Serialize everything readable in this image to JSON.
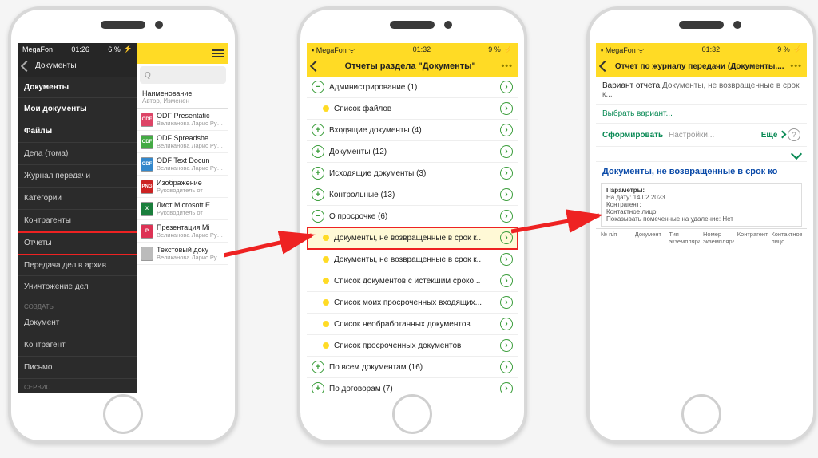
{
  "status": {
    "carrier": "MegaFon",
    "sig": "▪",
    "wifi": "ᯤ",
    "time1": "01:26",
    "time2": "01:32",
    "batt1": "6 %",
    "batt2": "9 %",
    "battic": "⚡"
  },
  "p1": {
    "sidebar": {
      "title": "Документы",
      "items": [
        "Документы",
        "Мои документы",
        "Файлы",
        "Дела (тома)",
        "Журнал передачи",
        "Категории",
        "Контрагенты",
        "Отчеты",
        "Передача дел в архив",
        "Уничтожение дел"
      ],
      "create": "СОЗДАТЬ",
      "create_items": [
        "Документ",
        "Контрагент",
        "Письмо"
      ],
      "service": "СЕРВИС"
    },
    "right": {
      "colhdr": "Наименование",
      "colsub": "Автор, Изменен",
      "files": [
        {
          "ic": "ODF",
          "c": "#d46",
          "n": "ODF Presentatiс",
          "m": "Великанова Ларис  Руководитель от"
        },
        {
          "ic": "ODF",
          "c": "#4a4",
          "n": "ODF Spreadshe",
          "m": "Великанова Ларис  Руководитель от"
        },
        {
          "ic": "ODF",
          "c": "#38c",
          "n": "ODF Text Docun",
          "m": "Великанова Ларис  Руководитель от"
        },
        {
          "ic": "PNG",
          "c": "#c22",
          "n": "Изображение",
          "m": "Руководитель от"
        },
        {
          "ic": "X",
          "c": "#1a7e3c",
          "n": "Лист Microsoft E",
          "m": "Руководитель от"
        },
        {
          "ic": "P",
          "c": "#d35",
          "n": "Презентация Mi",
          "m": "Великанова Ларис  Руководитель от"
        },
        {
          "ic": "",
          "c": "#bbb",
          "n": "Текстовый доку",
          "m": "Великанова Ларис  Руководитель от"
        }
      ]
    }
  },
  "p2": {
    "title": "Отчеты раздела \"Документы\"",
    "groups": [
      {
        "t": "minus",
        "label": "Администрирование (1)"
      },
      {
        "t": "bullet",
        "label": "Список файлов"
      },
      {
        "t": "plus",
        "label": "Входящие документы (4)"
      },
      {
        "t": "plus",
        "label": "Документы (12)"
      },
      {
        "t": "plus",
        "label": "Исходящие документы (3)"
      },
      {
        "t": "plus",
        "label": "Контрольные (13)"
      },
      {
        "t": "minus",
        "label": "О просрочке (6)"
      },
      {
        "t": "bullet",
        "label": "Документы, не возвращенные в срок к...",
        "hl": true
      },
      {
        "t": "bullet",
        "label": "Документы, не возвращенные в срок к..."
      },
      {
        "t": "bullet",
        "label": "Список документов с истекшим сроко..."
      },
      {
        "t": "bullet",
        "label": "Список моих просроченных входящих..."
      },
      {
        "t": "bullet",
        "label": "Список необработанных документов"
      },
      {
        "t": "bullet",
        "label": "Список просроченных документов"
      },
      {
        "t": "plus",
        "label": "По всем документам (16)"
      },
      {
        "t": "plus",
        "label": "По договорам (7)"
      },
      {
        "t": "plus",
        "label": "По задачам и процессам (1)"
      },
      {
        "t": "plus",
        "label": "По исполнителям (5)"
      }
    ]
  },
  "p3": {
    "title": "Отчет по журналу передачи (Документы,...",
    "variant_lbl": "Вариант отчета",
    "variant_val": "Документы, не возвращенные в срок к...",
    "choose": "Выбрать вариант...",
    "form_btn": "Сформировать",
    "settings": "Настройки...",
    "more": "Еще",
    "q": "?",
    "rtitle": "Документы, не возвращенные в срок ко",
    "params_lbl": "Параметры:",
    "params": [
      "На дату: 14.02.2023",
      "Контрагент:",
      "Контактное лицо:",
      "Показывать помеченные на удаление: Нет"
    ],
    "cols": [
      "№ п/п",
      "Документ",
      "Тип экземпляра",
      "Номер экземпляра",
      "Контрагент",
      "Контактное лицо"
    ]
  }
}
